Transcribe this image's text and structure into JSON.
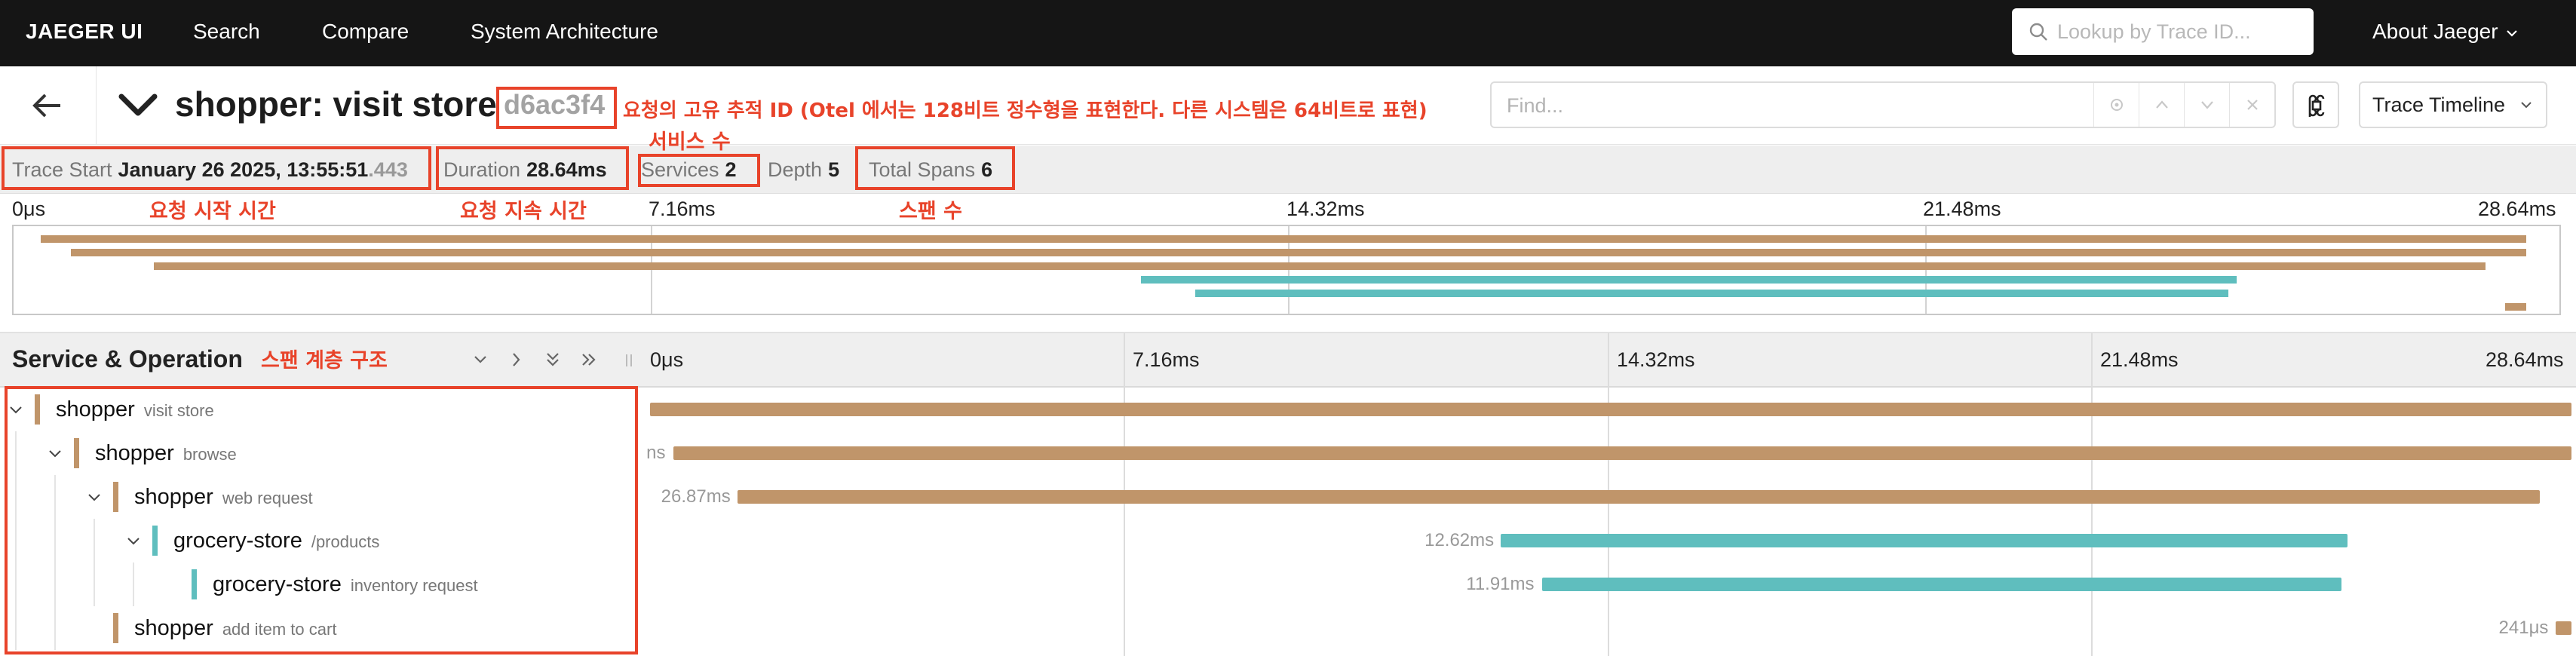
{
  "nav": {
    "logo": "JAEGER UI",
    "search": "Search",
    "compare": "Compare",
    "architecture": "System Architecture",
    "lookup_placeholder": "Lookup by Trace ID...",
    "about": "About Jaeger"
  },
  "trace": {
    "title": "shopper: visit store",
    "trace_id": "d6ac3f4",
    "find_placeholder": "Find...",
    "view_mode": "Trace Timeline"
  },
  "summary": {
    "trace_start_label": "Trace Start",
    "trace_start_value": "January 26 2025, 13:55:51",
    "trace_start_ms": ".443",
    "duration_label": "Duration",
    "duration_value": "28.64ms",
    "services_label": "Services",
    "services_value": "2",
    "depth_label": "Depth",
    "depth_value": "5",
    "total_spans_label": "Total Spans",
    "total_spans_value": "6"
  },
  "timeline": {
    "ticks": [
      "0μs",
      "7.16ms",
      "14.32ms",
      "21.48ms",
      "28.64ms"
    ],
    "total_ms": 28.64
  },
  "table": {
    "header": "Service & Operation"
  },
  "colors": {
    "shopper": "#c0956a",
    "grocery_store": "#5fbebe",
    "annotation": "#e8432a"
  },
  "spans": [
    {
      "service": "shopper",
      "operation": "visit store",
      "depth": 0,
      "start_ms": 0,
      "duration_ms": 28.64,
      "label": "",
      "color": "shopper",
      "expanded": true
    },
    {
      "service": "shopper",
      "operation": "browse",
      "depth": 1,
      "start_ms": 0.35,
      "duration_ms": 28.29,
      "label": "ns",
      "color": "shopper",
      "expanded": true
    },
    {
      "service": "shopper",
      "operation": "web request",
      "depth": 2,
      "start_ms": 1.3,
      "duration_ms": 26.87,
      "label": "26.87ms",
      "color": "shopper",
      "expanded": true
    },
    {
      "service": "grocery-store",
      "operation": "/products",
      "depth": 3,
      "start_ms": 12.68,
      "duration_ms": 12.62,
      "label": "12.62ms",
      "color": "grocery_store",
      "expanded": true
    },
    {
      "service": "grocery-store",
      "operation": "inventory request",
      "depth": 4,
      "start_ms": 13.3,
      "duration_ms": 11.91,
      "label": "11.91ms",
      "color": "grocery_store",
      "expanded": false
    },
    {
      "service": "shopper",
      "operation": "add item to cart",
      "depth": 2,
      "start_ms": 28.4,
      "duration_ms": 0.241,
      "label": "241μs",
      "color": "shopper",
      "expanded": false
    }
  ],
  "annotations": {
    "trace_id_note": "요청의 고유 추적 ID (Otel 에서는 128비트 정수형을 표현한다. 다른 시스템은 64비트로 표현)",
    "services_note": "서비스 수",
    "start_note": "요청 시작 시간",
    "duration_note": "요청 지속 시간",
    "spans_note": "스팬 수",
    "hierarchy_note": "스팬 계층 구조"
  }
}
